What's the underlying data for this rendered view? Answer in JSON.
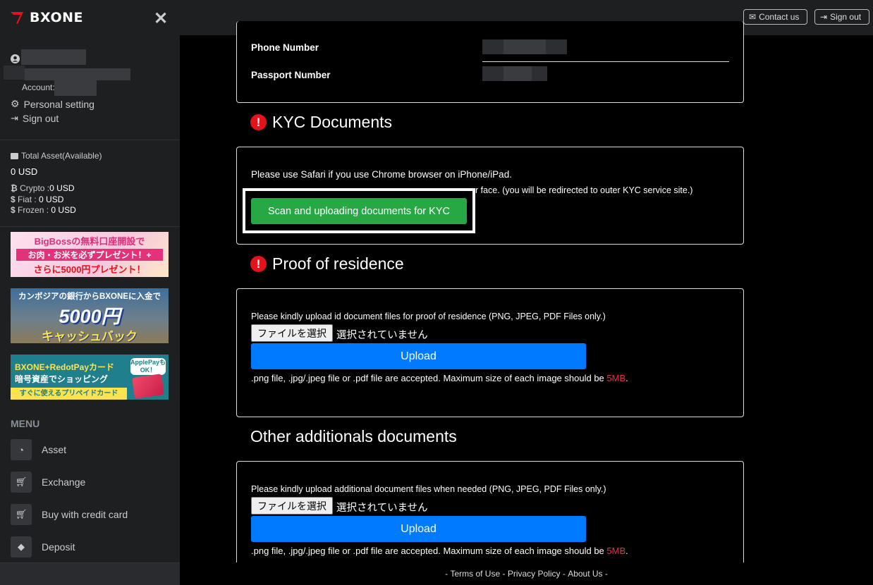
{
  "brand": {
    "name": "BXONE"
  },
  "sidebar": {
    "account_label": "Account:",
    "personal_setting": "Personal setting",
    "sign_out": "Sign out",
    "total_asset_label": "Total Asset(Available)",
    "total_asset_value": "0 USD",
    "crypto_label": "Crypto :",
    "crypto_value": "0 USD",
    "fiat_label": "Fiat : ",
    "fiat_value": "0 USD",
    "frozen_label": "Frozen : ",
    "frozen_value": "0 USD",
    "banners": [
      {
        "line1": "BigBossの無料口座開設で",
        "line2": "お肉・お米を必ずプレゼント！+",
        "line3": "さらに5000円プレゼント！"
      },
      {
        "line1": "カンボジアの銀行からBXONEに入金で",
        "line2": "5000円",
        "line3": "キャッシュバック"
      },
      {
        "line1": "BXONE+RedotPayカード",
        "line2": "暗号資産でショッピング",
        "line3": "すぐに使えるプリペイドカード",
        "badge": "ApplePayも OK！"
      }
    ],
    "menu_title": "MENU",
    "menu": [
      {
        "label": "Asset",
        "icon": "gauge-icon"
      },
      {
        "label": "Exchange",
        "icon": "cart-icon"
      },
      {
        "label": "Buy with credit card",
        "icon": "cart-icon"
      },
      {
        "label": "Deposit",
        "icon": "diamond-icon"
      }
    ]
  },
  "topbar": {
    "contact": "Contact us",
    "signout": "Sign out"
  },
  "profile": {
    "phone_label": "Phone Number",
    "passport_label": "Passport Number"
  },
  "kyc": {
    "title": "KYC Documents",
    "safari_note": "Please use Safari if you use Chrome browser on iPhone/iPad.",
    "face_note_tail": "r face. (you will be redirected to outer KYC service site.)",
    "scan_button": "Scan and uploading documents for KYC"
  },
  "residence": {
    "title": "Proof of residence",
    "instruction": "Please kindly upload id document files for proof of residence (PNG, JPEG, PDF Files only.)",
    "file_button": "ファイルを選択",
    "no_file": "選択されていません",
    "upload_button": "Upload",
    "note_prefix": ".png file, .jpg/.jpeg file or .pdf file are accepted. Maximum size of each image should be ",
    "note_limit": "5MB",
    "note_suffix": "."
  },
  "additional": {
    "title": "Other additionals documents",
    "instruction": "Please kindly upload additional document files when needed (PNG, JPEG, PDF Files only.)",
    "file_button": "ファイルを選択",
    "no_file": "選択されていません",
    "upload_button": "Upload",
    "note_prefix": ".png file, .jpg/.jpeg file or .pdf file are accepted. Maximum size of each image should be ",
    "note_limit": "5MB",
    "note_suffix": "."
  },
  "footer": {
    "sep": "-",
    "terms": "Terms of Use",
    "privacy": "Privacy Policy",
    "about": "About Us"
  }
}
